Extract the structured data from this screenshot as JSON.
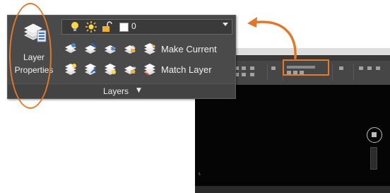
{
  "colors": {
    "accent_orange": "#e0782a",
    "panel_bg": "#4a4a4a",
    "panel_text": "#f0f0f0",
    "drawing_area": "#000000"
  },
  "layers_panel": {
    "title": "Layers",
    "layer_properties": {
      "line1": "Layer",
      "line2": "Properties",
      "icon": "layer-stack-icon"
    },
    "layer_dropdown": {
      "current_value": "0",
      "icons": [
        "lightbulb-icon",
        "sun-icon",
        "unlock-icon"
      ]
    },
    "tool_row_1": {
      "icons": [
        "layer-off-icon",
        "layer-isolate-icon",
        "layer-freeze-icon",
        "layer-lock-icon"
      ],
      "make_current_label": "Make Current"
    },
    "tool_row_2": {
      "icons": [
        "layer-on-icon",
        "layer-unisolate-icon",
        "layer-thaw-icon",
        "layer-unlock-icon"
      ],
      "match_layer_label": "Match Layer"
    }
  }
}
